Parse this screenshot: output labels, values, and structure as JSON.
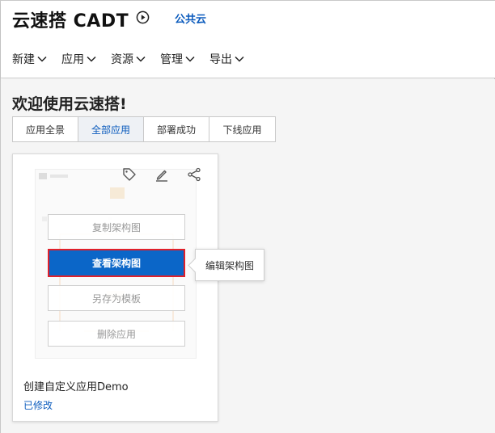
{
  "header": {
    "brand": "云速搭 CADT",
    "play_icon": "play-circle-icon",
    "cloud_link": "公共云"
  },
  "nav": {
    "items": [
      {
        "label": "新建"
      },
      {
        "label": "应用"
      },
      {
        "label": "资源"
      },
      {
        "label": "管理"
      },
      {
        "label": "导出"
      }
    ]
  },
  "main": {
    "welcome": "欢迎使用云速搭!",
    "tabs": [
      {
        "label": "应用全景",
        "active": false
      },
      {
        "label": "全部应用",
        "active": true
      },
      {
        "label": "部署成功",
        "active": false
      },
      {
        "label": "下线应用",
        "active": false
      }
    ]
  },
  "card": {
    "toolbar_icons": [
      "tag-icon",
      "edit-icon",
      "share-icon"
    ],
    "menu": {
      "copy": "复制架构图",
      "view": "查看架构图",
      "save_template": "另存为模板",
      "delete": "删除应用"
    },
    "title": "创建自定义应用Demo",
    "status": "已修改"
  },
  "tooltip": {
    "label": "编辑架构图"
  },
  "colors": {
    "accent": "#0b66c8",
    "link": "#0b5bbd",
    "highlight_border": "#e0202a"
  }
}
